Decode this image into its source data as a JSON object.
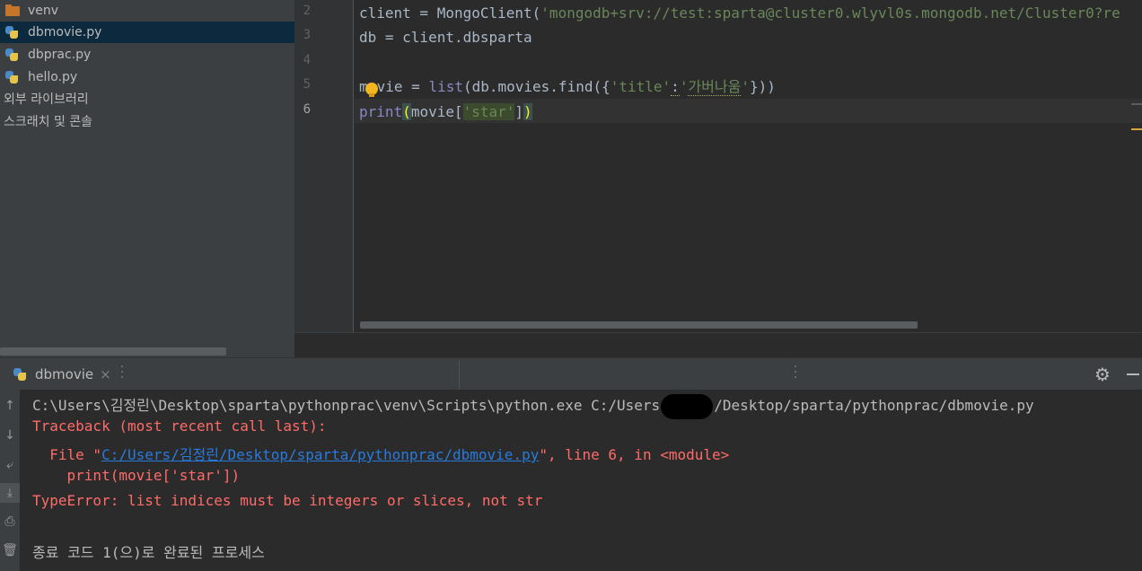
{
  "project": {
    "items": [
      {
        "label": "venv",
        "icon": "folder-icon",
        "selected": false
      },
      {
        "label": "dbmovie.py",
        "icon": "python-file-icon",
        "selected": true
      },
      {
        "label": "dbprac.py",
        "icon": "python-file-icon",
        "selected": false
      },
      {
        "label": "hello.py",
        "icon": "python-file-icon",
        "selected": false
      },
      {
        "label": "외부 라이브러리",
        "icon": "",
        "selected": false
      },
      {
        "label": "스크래치 및 콘솔",
        "icon": "",
        "selected": false
      }
    ]
  },
  "editor": {
    "line_numbers": [
      "2",
      "3",
      "4",
      "5",
      "6"
    ],
    "current_line": "6",
    "line2": {
      "a": "client = MongoClient(",
      "str": "'mongodb+srv://test:sparta@cluster0.wlyvl0s.mongodb.net/Cluster0?re"
    },
    "line3": "db = client.dbsparta",
    "line5": {
      "a": "m",
      "b": "vie = ",
      "list": "list",
      "c": "(db.movies.find({",
      "s1": "'title'",
      "colon": ":",
      "s2a": "'",
      "s2b": "가버나움",
      "s2c": "'",
      "d": "}))"
    },
    "line6": {
      "print": "print",
      "open": "(",
      "mid": "movie[",
      "str": "'star'",
      "close_b": "]",
      "close": ")"
    }
  },
  "run": {
    "tab_label": "dbmovie",
    "tab_close": "×",
    "console": {
      "cmd_a": "C:\\Users\\김정린\\Desktop\\sparta\\pythonprac\\venv\\Scripts\\python.exe C:/Users",
      "cmd_b": "/Desktop/sparta/pythonprac/dbmovie.py",
      "traceback": "Traceback (most recent call last):",
      "file_pre": "  File \"",
      "file_link": "C:/Users/김정린/Desktop/sparta/pythonprac/dbmovie.py",
      "file_post": "\", line 6, in <module>",
      "code": "    print(movie['star'])",
      "error": "TypeError: list indices must be integers or slices, not str",
      "exit": "종료 코드 1(으)로 완료된 프로세스"
    }
  },
  "colors": {
    "error": "#ff6b68",
    "link": "#287bde",
    "keyword": "#cc7832",
    "string": "#6a8759"
  }
}
